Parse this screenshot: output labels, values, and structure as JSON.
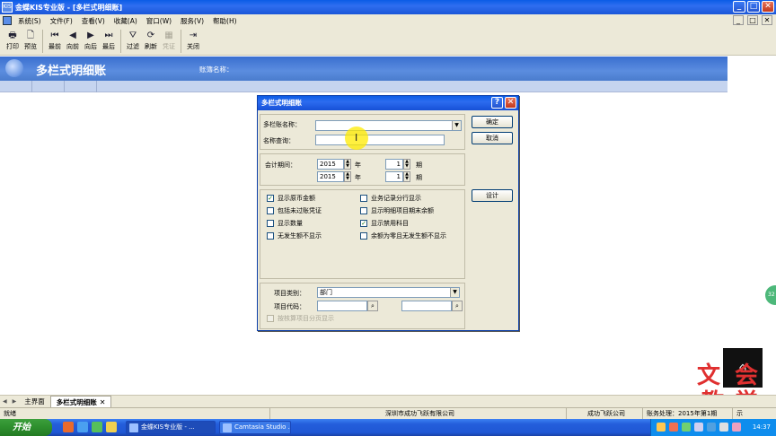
{
  "window": {
    "title": "金蝶KIS专业版 - [多栏式明细账]",
    "app_icon_text": "KIS",
    "minimize": "_",
    "maximize": "□",
    "close": "✕"
  },
  "menu": [
    "系统(S)",
    "文件(F)",
    "查看(V)",
    "收藏(A)",
    "窗口(W)",
    "服务(V)",
    "帮助(H)"
  ],
  "mdi_controls": [
    "_",
    "□",
    "✕"
  ],
  "toolbar": [
    {
      "icon": "🖶",
      "label": "打印",
      "disabled": false
    },
    {
      "icon": "🗋",
      "label": "预览",
      "disabled": false
    },
    {
      "icon": "⏮",
      "label": "最前",
      "disabled": false
    },
    {
      "icon": "◀",
      "label": "向前",
      "disabled": false
    },
    {
      "icon": "▶",
      "label": "向后",
      "disabled": false
    },
    {
      "icon": "⏭",
      "label": "最后",
      "disabled": false
    },
    {
      "icon": "⛛",
      "label": "过滤",
      "disabled": false
    },
    {
      "icon": "⟳",
      "label": "刷新",
      "disabled": false
    },
    {
      "icon": "▦",
      "label": "凭证",
      "disabled": true
    },
    {
      "icon": "⇥",
      "label": "关闭",
      "disabled": false
    }
  ],
  "banner": {
    "title": "多栏式明细账",
    "account_label": "账簿名称："
  },
  "dialog": {
    "title": "多栏式明细账",
    "help": "?",
    "close": "✕",
    "multi_account_label": "多栏账名称：",
    "multi_account_value": "",
    "name_query_label": "名称查询：",
    "name_query_value": "",
    "period_label": "会计期间：",
    "from_year": "2015",
    "from_period": "1",
    "to_year": "2015",
    "to_period": "1",
    "year_unit": "年",
    "period_unit": "期",
    "ok_button": "确定",
    "cancel_button": "取消",
    "design_button": "设计",
    "options": [
      {
        "label": "显示原币金额",
        "checked": true
      },
      {
        "label": "业务记录分行显示",
        "checked": false
      },
      {
        "label": "包括未过账凭证",
        "checked": false
      },
      {
        "label": "显示明细项目期末余额",
        "checked": false
      },
      {
        "label": "显示数量",
        "checked": false
      },
      {
        "label": "显示禁用科目",
        "checked": true
      },
      {
        "label": "无发生额不显示",
        "checked": false
      },
      {
        "label": "余额为零且无发生额不显示",
        "checked": false
      }
    ],
    "item_category_label": "项目类别：",
    "item_category_value": "部门",
    "item_code_label": "项目代码：",
    "item_code_from": "",
    "item_code_to": "",
    "split_display_label": "按核算项目分页显示",
    "split_display_disabled": true
  },
  "side_widget": "32",
  "watermark": {
    "top_left": "文",
    "top_right": "会",
    "bottom_left": "教",
    "bottom_right": "学",
    "logo": "⌂"
  },
  "tabs": [
    {
      "label": "主界面",
      "active": false
    },
    {
      "label": "多栏式明细账",
      "active": true,
      "closable": true
    }
  ],
  "status": {
    "left": "就绪",
    "company": "深圳市成功飞跃有限公司",
    "user": "成功飞跃公司",
    "ledger": "账务处理：2015年第1期",
    "extra": "示"
  },
  "taskbar": {
    "start": "开始",
    "tasks": [
      {
        "label": "金蝶KIS专业版 - ...",
        "active": true
      },
      {
        "label": "Camtasia Studio ...",
        "active": false
      }
    ],
    "clock": "14:37"
  }
}
